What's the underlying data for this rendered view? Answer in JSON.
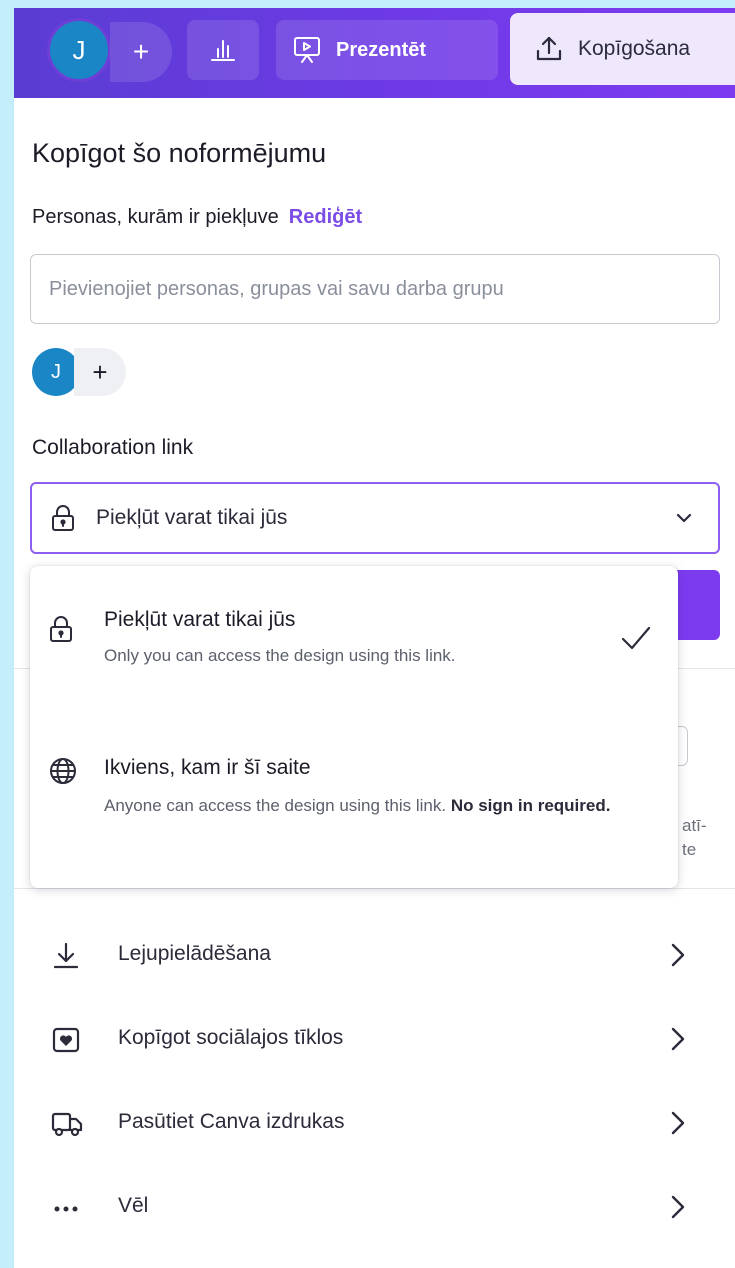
{
  "topbar": {
    "avatar_initial": "J",
    "add_label": "+",
    "present_label": "Prezentēt",
    "share_label": "Kopīgošana"
  },
  "share_panel": {
    "title": "Kopīgot šo noformējumu",
    "people_label": "Personas, kurām ir piekļuve",
    "edit_link": "Rediģēt",
    "people_input_placeholder": "Pievienojiet personas, grupas vai savu darba grupu",
    "member_initial": "J",
    "add_member_label": "+",
    "collab_label": "Collaboration link",
    "collab_selected": "Piekļūt varat tikai jūs",
    "peek_text_1": "atī-",
    "peek_text_2": "te"
  },
  "dropdown": {
    "options": [
      {
        "title": "Piekļūt varat tikai jūs",
        "description": "Only you can access the design using this link.",
        "selected": true
      },
      {
        "title": "Ikviens, kam ir šī saite",
        "description": "Anyone can access the design using this link. ",
        "description_bold": "No sign in required.",
        "selected": false
      }
    ]
  },
  "menu": {
    "items": [
      {
        "label": "Lejupielādēšana",
        "icon": "download-icon"
      },
      {
        "label": "Kopīgot sociālajos tīklos",
        "icon": "heart-icon"
      },
      {
        "label": "Pasūtiet Canva izdrukas",
        "icon": "truck-icon"
      },
      {
        "label": "Vēl",
        "icon": "more-icon"
      }
    ]
  },
  "colors": {
    "accent": "#7b4ce6",
    "topbar_start": "#5a3cd2",
    "topbar_end": "#7d3bf0",
    "avatar": "#1b86c5",
    "page_background": "#c4eefb"
  }
}
